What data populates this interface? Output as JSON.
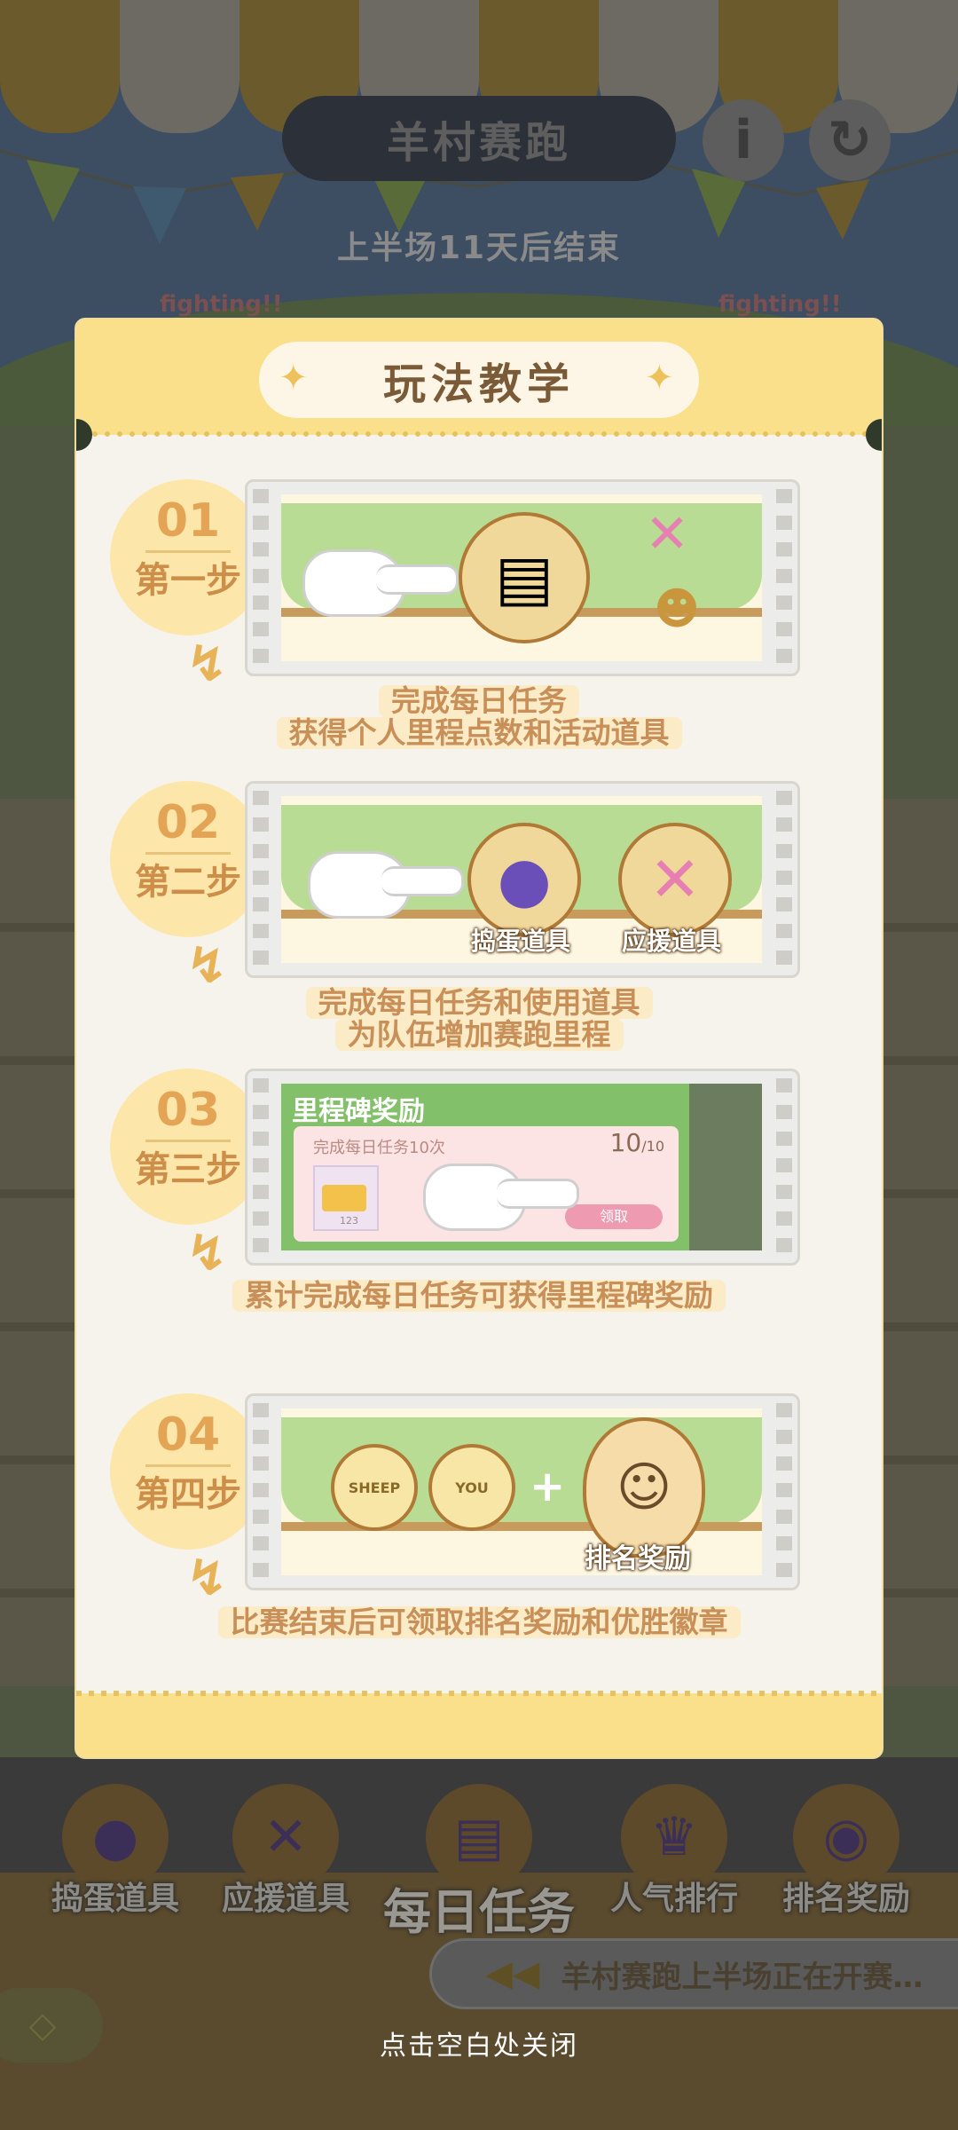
{
  "header": {
    "title": "羊村赛跑",
    "subtitle": "上半场11天后结束",
    "info_icon": "i",
    "refresh_icon": "↻",
    "fighting_text": "fighting!!"
  },
  "modal": {
    "title": "玩法教学",
    "steps": [
      {
        "num": "01",
        "name": "第一步",
        "desc_lines": [
          "完成每日任务",
          "获得个人里程点数和活动道具"
        ]
      },
      {
        "num": "02",
        "name": "第二步",
        "desc_lines": [
          "完成每日任务和使用道具",
          "为队伍增加赛跑里程"
        ],
        "tags": [
          "捣蛋道具",
          "应援道具"
        ]
      },
      {
        "num": "03",
        "name": "第三步",
        "desc_lines": [
          "累计完成每日任务可获得里程碑奖励"
        ],
        "milestone": {
          "title": "里程碑奖励",
          "task": "完成每日任务10次",
          "count": "10",
          "total": "/10",
          "qty": "123",
          "claim": "领取"
        }
      },
      {
        "num": "04",
        "name": "第四步",
        "desc_lines": [
          "比赛结束后可领取排名奖励和优胜徽章"
        ],
        "tags": [
          "排名奖励"
        ],
        "badges": [
          "SHEEP",
          "YOU"
        ]
      }
    ]
  },
  "bottom_nav": {
    "items": [
      "捣蛋道具",
      "应援道具",
      "每日任务",
      "人气排行",
      "排名奖励"
    ]
  },
  "ticker": {
    "text": "羊村赛跑上半场正在开赛…"
  },
  "close_hint": "点击空白处关闭"
}
